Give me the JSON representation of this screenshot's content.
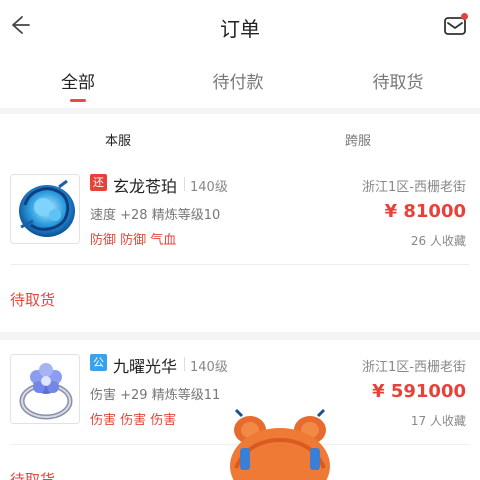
{
  "header": {
    "title": "订单",
    "back_icon": "arrow-left-icon",
    "mail_icon": "mail-icon"
  },
  "tabs": [
    {
      "label": "全部",
      "active": true
    },
    {
      "label": "待付款",
      "active": false
    },
    {
      "label": "待取货",
      "active": false
    }
  ],
  "subtabs": [
    {
      "label": "本服",
      "active": true
    },
    {
      "label": "跨服",
      "active": false
    }
  ],
  "orders": [
    {
      "badge": "还",
      "badge_color": "#e8413a",
      "name": "玄龙苍珀",
      "level": "140级",
      "stats": "速度 +28 精炼等级10",
      "attrs": "防御 防御 气血",
      "server": "浙江1区-西栅老街",
      "price": "¥ 81000",
      "favorites": "26 人收藏",
      "status": "待取货"
    },
    {
      "badge": "公",
      "badge_color": "#3aa2ea",
      "name": "九曜光华",
      "level": "140级",
      "stats": "伤害 +29 精炼等级11",
      "attrs": "伤害 伤害 伤害",
      "server": "浙江1区-西栅老街",
      "price": "¥ 591000",
      "favorites": "17 人收藏",
      "status": "待取货"
    }
  ],
  "colors": {
    "accent": "#e8413a",
    "tab_underline": "#ea4b3f"
  }
}
